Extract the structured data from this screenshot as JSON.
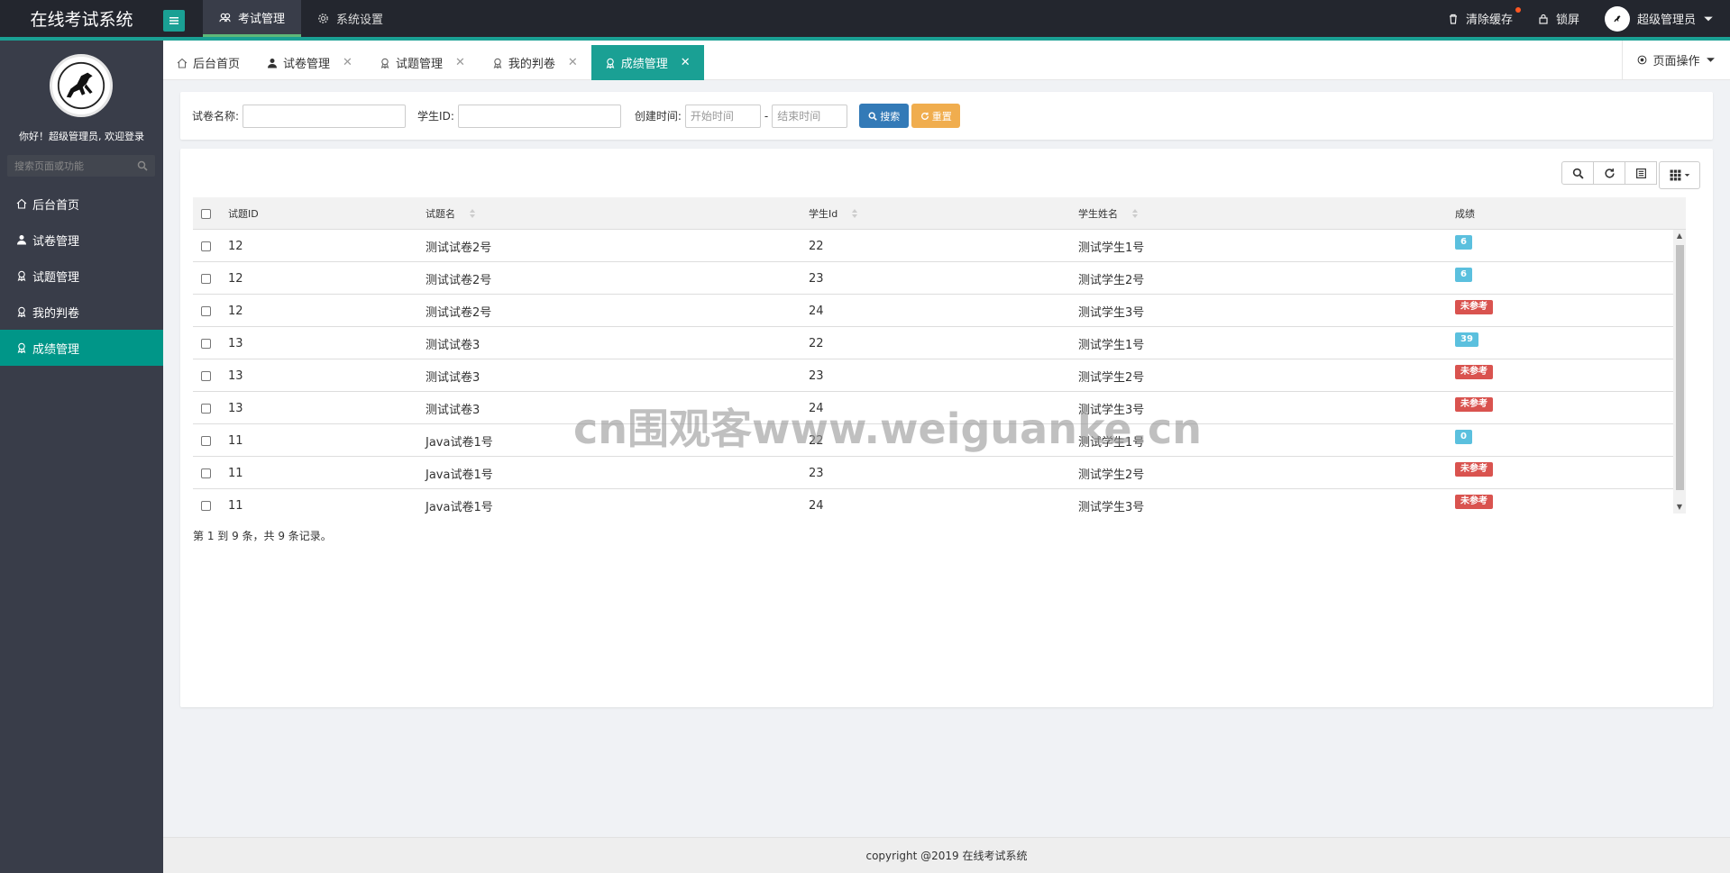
{
  "app": {
    "title": "在线考试系统"
  },
  "topnav": [
    {
      "label": "考试管理",
      "icon": "users-icon",
      "active": true
    },
    {
      "label": "系统设置",
      "icon": "gear-icon",
      "active": false
    }
  ],
  "topright": {
    "clear_cache": "清除缓存",
    "lock": "锁屏",
    "user": "超级管理员"
  },
  "sidebar": {
    "welcome": "你好！超级管理员, 欢迎登录",
    "search_placeholder": "搜索页面或功能",
    "items": [
      {
        "label": "后台首页",
        "icon": "home-icon"
      },
      {
        "label": "试卷管理",
        "icon": "user-icon"
      },
      {
        "label": "试题管理",
        "icon": "award-icon"
      },
      {
        "label": "我的判卷",
        "icon": "award-icon"
      },
      {
        "label": "成绩管理",
        "icon": "award-icon",
        "active": true
      }
    ]
  },
  "tabs": [
    {
      "label": "后台首页",
      "closable": false
    },
    {
      "label": "试卷管理",
      "closable": true
    },
    {
      "label": "试题管理",
      "closable": true
    },
    {
      "label": "我的判卷",
      "closable": true
    },
    {
      "label": "成绩管理",
      "closable": true,
      "active": true
    }
  ],
  "page_ops": "页面操作",
  "search": {
    "paper_name_label": "试卷名称:",
    "student_id_label": "学生ID:",
    "create_time_label": "创建时间:",
    "start_placeholder": "开始时间",
    "end_placeholder": "结束时间",
    "dash": "-",
    "search_btn": "搜索",
    "reset_btn": "重置"
  },
  "table": {
    "columns": [
      "试题ID",
      "试题名",
      "学生Id",
      "学生姓名",
      "成绩"
    ],
    "rows": [
      {
        "id": "12",
        "name": "测试试卷2号",
        "sid": "22",
        "sname": "测试学生1号",
        "score": "6",
        "type": "info"
      },
      {
        "id": "12",
        "name": "测试试卷2号",
        "sid": "23",
        "sname": "测试学生2号",
        "score": "6",
        "type": "info"
      },
      {
        "id": "12",
        "name": "测试试卷2号",
        "sid": "24",
        "sname": "测试学生3号",
        "score": "未参考",
        "type": "danger"
      },
      {
        "id": "13",
        "name": "测试试卷3",
        "sid": "22",
        "sname": "测试学生1号",
        "score": "39",
        "type": "info"
      },
      {
        "id": "13",
        "name": "测试试卷3",
        "sid": "23",
        "sname": "测试学生2号",
        "score": "未参考",
        "type": "danger"
      },
      {
        "id": "13",
        "name": "测试试卷3",
        "sid": "24",
        "sname": "测试学生3号",
        "score": "未参考",
        "type": "danger"
      },
      {
        "id": "11",
        "name": "Java试卷1号",
        "sid": "22",
        "sname": "测试学生1号",
        "score": "0",
        "type": "info"
      },
      {
        "id": "11",
        "name": "Java试卷1号",
        "sid": "23",
        "sname": "测试学生2号",
        "score": "未参考",
        "type": "danger"
      },
      {
        "id": "11",
        "name": "Java试卷1号",
        "sid": "24",
        "sname": "测试学生3号",
        "score": "未参考",
        "type": "danger"
      }
    ],
    "pagination": "第 1 到 9 条，共 9 条记录。"
  },
  "watermark": "cn围观客www.weiguanke.cn",
  "footer": "copyright @2019 在线考试系统",
  "colors": {
    "accent": "#009688",
    "tab_active": "#1aa094",
    "topbar": "#23262e",
    "sidebar": "#393d49"
  }
}
